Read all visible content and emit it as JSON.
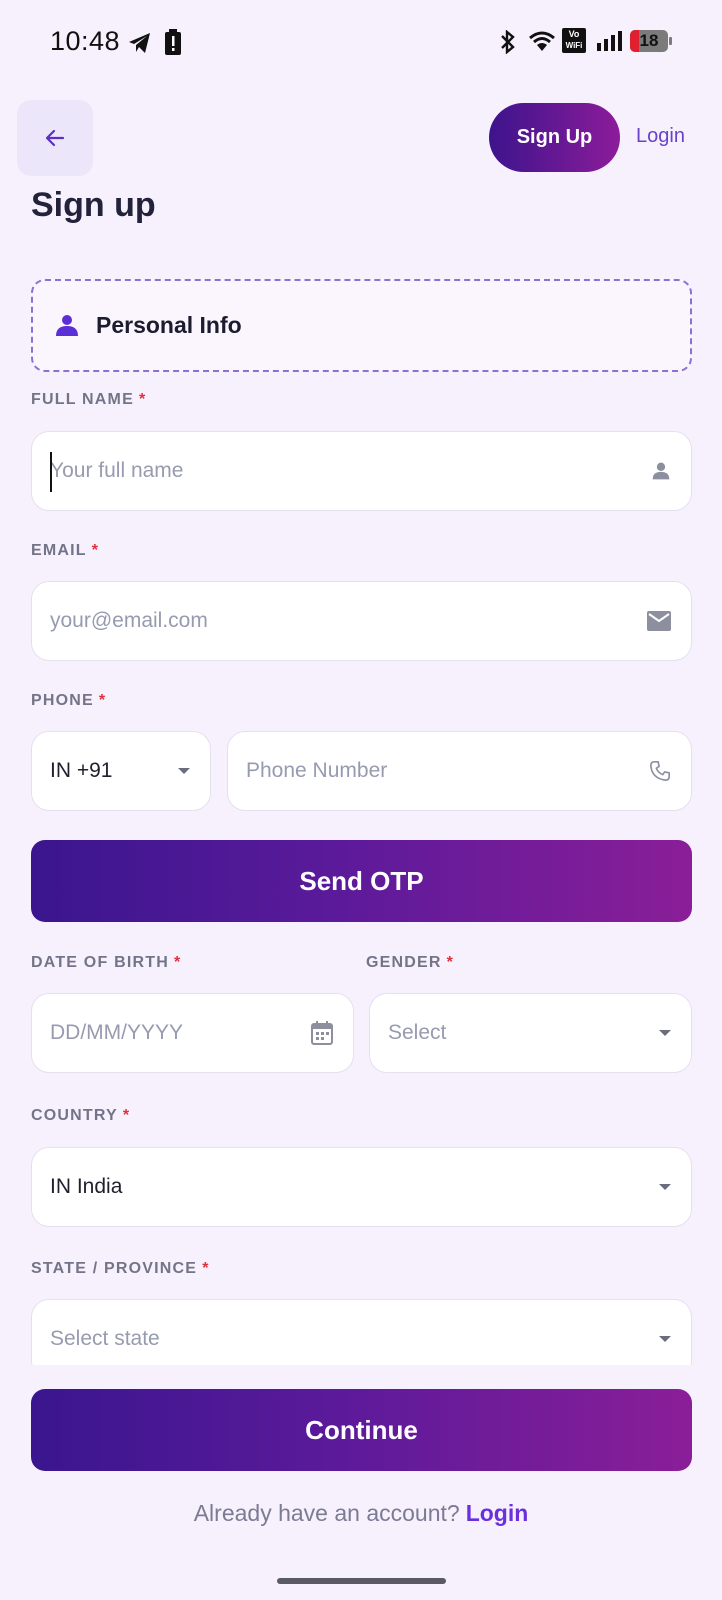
{
  "status_bar": {
    "time": "10:48",
    "battery_level": "18",
    "vowifi_top": "Vo",
    "vowifi_bottom": "WiFi"
  },
  "header": {
    "signup_pill": "Sign Up",
    "login_link": "Login",
    "page_title": "Sign up"
  },
  "section": {
    "title": "Personal Info"
  },
  "form": {
    "full_name": {
      "label": "FULL NAME",
      "required": "*",
      "placeholder": "Your full name"
    },
    "email": {
      "label": "EMAIL",
      "required": "*",
      "placeholder": "your@email.com"
    },
    "phone": {
      "label": "PHONE",
      "required": "*",
      "country_code": "IN +91",
      "placeholder": "Phone Number"
    },
    "send_otp": "Send OTP",
    "dob": {
      "label": "DATE OF BIRTH",
      "required": "*",
      "placeholder": "DD/MM/YYYY"
    },
    "gender": {
      "label": "GENDER",
      "required": "*",
      "placeholder": "Select"
    },
    "country": {
      "label": "COUNTRY",
      "required": "*",
      "value": "IN India"
    },
    "state": {
      "label": "STATE / PROVINCE",
      "required": "*",
      "placeholder": "Select state"
    }
  },
  "footer": {
    "continue": "Continue",
    "already_text": "Already have an account?",
    "login_link": "Login"
  },
  "colors": {
    "background": "#f7f1fd",
    "accent": "#6a30dc",
    "gradient_start": "#3a168e",
    "gradient_end": "#8a1e98",
    "required": "#e0313b"
  }
}
